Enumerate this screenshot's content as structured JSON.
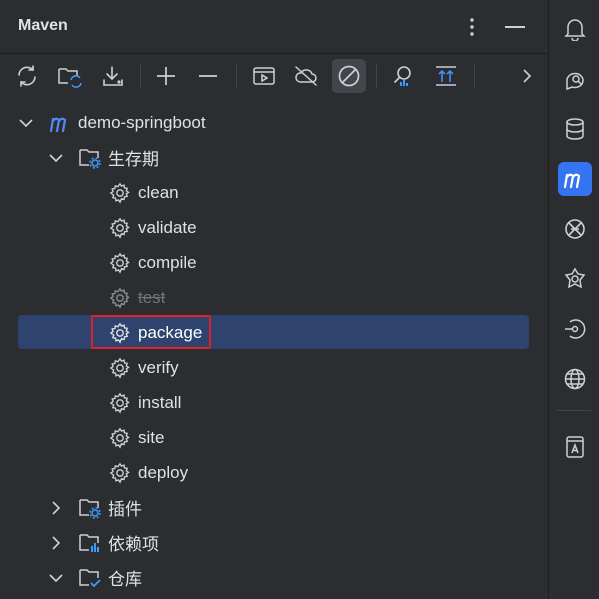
{
  "header": {
    "title": "Maven",
    "more_icon": "more-vertical-icon",
    "minimize_icon": "minimize-icon"
  },
  "toolbar": {
    "buttons": [
      "reload-all-projects-icon",
      "generate-sources-icon",
      "download-sources-icon",
      "add-project-icon",
      "remove-project-icon",
      "run-maven-build-icon",
      "toggle-offline-mode-icon",
      "skip-tests-icon",
      "analyze-dependencies-icon",
      "collapse-all-icon",
      "more-chevron-icon"
    ]
  },
  "tree": {
    "project": "demo-springboot",
    "lifecycle": "生存期",
    "lifecycle_items": [
      "clean",
      "validate",
      "compile",
      "test",
      "package",
      "verify",
      "install",
      "site",
      "deploy"
    ],
    "plugins": "插件",
    "dependencies": "依赖项",
    "repositories": "仓库"
  },
  "right_strip": {
    "icons": [
      "notifications-icon",
      "ai-assistant-icon",
      "database-icon",
      "maven-icon",
      "tool-window-icon",
      "plugin-icon",
      "endpoints-icon",
      "web-icon",
      "documentation-icon"
    ]
  },
  "colors": {
    "background": "#2b2d30",
    "selection": "#2e436e",
    "accent": "#3574f0",
    "highlight_border": "#e0202a",
    "text": "#dfe1e5"
  }
}
